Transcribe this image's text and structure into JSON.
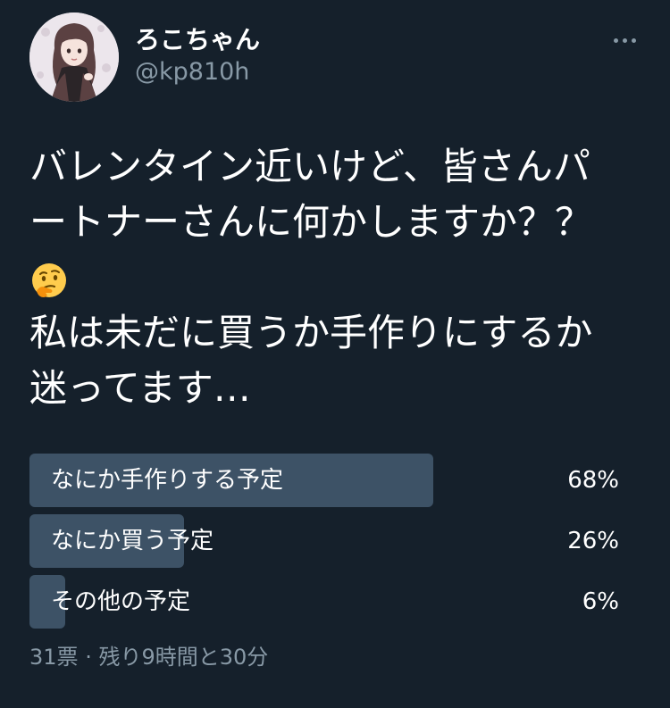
{
  "user": {
    "display_name": "ろこちゃん",
    "handle": "@kp810h"
  },
  "tweet": {
    "line1": "バレンタイン近いけど、皆さんパ",
    "line2": "ートナーさんに何かしますか？？",
    "emoji": "thinking-face-icon",
    "line4": "私は未だに買うか手作りにするか",
    "line5": "迷ってます…"
  },
  "poll": {
    "options": [
      {
        "label": "なにか手作りする予定",
        "percent_text": "68%",
        "percent": 68
      },
      {
        "label": "なにか買う予定",
        "percent_text": "26%",
        "percent": 26
      },
      {
        "label": "その他の予定",
        "percent_text": "6%",
        "percent": 6
      }
    ],
    "votes_text": "31票",
    "separator": "·",
    "time_left_text": "残り9時間と30分"
  },
  "colors": {
    "background": "#15202b",
    "bar": "#3d5266",
    "secondary_text": "#8899a6"
  }
}
